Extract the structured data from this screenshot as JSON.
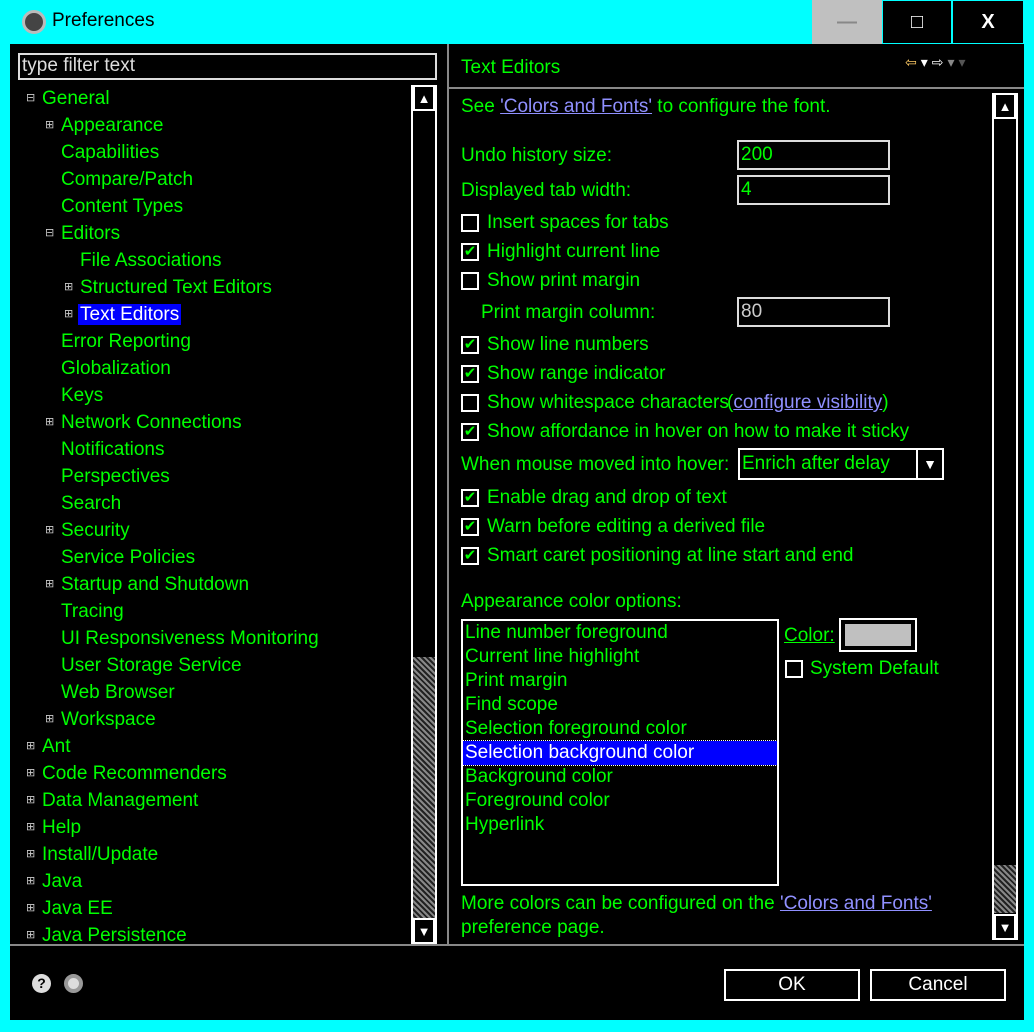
{
  "window": {
    "title": "Preferences",
    "minimize": "—",
    "maximize": "□",
    "close": "X"
  },
  "filter": {
    "placeholder": "type filter text"
  },
  "tree": [
    {
      "label": "General",
      "depth": 0,
      "exp": "-"
    },
    {
      "label": "Appearance",
      "depth": 1,
      "exp": "+"
    },
    {
      "label": "Capabilities",
      "depth": 1,
      "exp": ""
    },
    {
      "label": "Compare/Patch",
      "depth": 1,
      "exp": ""
    },
    {
      "label": "Content Types",
      "depth": 1,
      "exp": ""
    },
    {
      "label": "Editors",
      "depth": 1,
      "exp": "-"
    },
    {
      "label": "File Associations",
      "depth": 2,
      "exp": ""
    },
    {
      "label": "Structured Text Editors",
      "depth": 2,
      "exp": "+"
    },
    {
      "label": "Text Editors",
      "depth": 2,
      "exp": "+",
      "selected": true
    },
    {
      "label": "Error Reporting",
      "depth": 1,
      "exp": ""
    },
    {
      "label": "Globalization",
      "depth": 1,
      "exp": ""
    },
    {
      "label": "Keys",
      "depth": 1,
      "exp": ""
    },
    {
      "label": "Network Connections",
      "depth": 1,
      "exp": "+"
    },
    {
      "label": "Notifications",
      "depth": 1,
      "exp": ""
    },
    {
      "label": "Perspectives",
      "depth": 1,
      "exp": ""
    },
    {
      "label": "Search",
      "depth": 1,
      "exp": ""
    },
    {
      "label": "Security",
      "depth": 1,
      "exp": "+"
    },
    {
      "label": "Service Policies",
      "depth": 1,
      "exp": ""
    },
    {
      "label": "Startup and Shutdown",
      "depth": 1,
      "exp": "+"
    },
    {
      "label": "Tracing",
      "depth": 1,
      "exp": ""
    },
    {
      "label": "UI Responsiveness Monitoring",
      "depth": 1,
      "exp": ""
    },
    {
      "label": "User Storage Service",
      "depth": 1,
      "exp": ""
    },
    {
      "label": "Web Browser",
      "depth": 1,
      "exp": ""
    },
    {
      "label": "Workspace",
      "depth": 1,
      "exp": "+"
    },
    {
      "label": "Ant",
      "depth": 0,
      "exp": "+"
    },
    {
      "label": "Code Recommenders",
      "depth": 0,
      "exp": "+"
    },
    {
      "label": "Data Management",
      "depth": 0,
      "exp": "+"
    },
    {
      "label": "Help",
      "depth": 0,
      "exp": "+"
    },
    {
      "label": "Install/Update",
      "depth": 0,
      "exp": "+"
    },
    {
      "label": "Java",
      "depth": 0,
      "exp": "+"
    },
    {
      "label": "Java EE",
      "depth": 0,
      "exp": "+"
    },
    {
      "label": "Java Persistence",
      "depth": 0,
      "exp": "+"
    }
  ],
  "page": {
    "title": "Text Editors",
    "intro_pre": "See ",
    "intro_link": "'Colors and Fonts'",
    "intro_post": " to configure the font.",
    "undo_label": "Undo history size:",
    "undo_value": "200",
    "tab_label": "Displayed tab width:",
    "tab_value": "4",
    "checkboxes": [
      {
        "label": "Insert spaces for tabs",
        "checked": false
      },
      {
        "label": "Highlight current line",
        "checked": true
      },
      {
        "label": "Show print margin",
        "checked": false
      }
    ],
    "margin_label": "Print margin column:",
    "margin_value": "80",
    "checkboxes2": [
      {
        "label": "Show line numbers",
        "checked": true
      },
      {
        "label": "Show range indicator",
        "checked": true
      },
      {
        "label": "Show whitespace characters",
        "checked": false
      },
      {
        "label": "Show affordance in hover on how to make it sticky",
        "checked": true
      }
    ],
    "whitespace_link_open": "(",
    "whitespace_link": "configure visibility",
    "whitespace_link_close": ")",
    "hover_label": "When mouse moved into hover:",
    "hover_value": "Enrich after delay",
    "checkboxes3": [
      {
        "label": "Enable drag and drop of text",
        "checked": true
      },
      {
        "label": "Warn before editing a derived file",
        "checked": true
      },
      {
        "label": "Smart caret positioning at line start and end",
        "checked": true
      }
    ],
    "appearance_label": "Appearance color options:",
    "color_items": [
      "Line number foreground",
      "Current line highlight",
      "Print margin",
      "Find scope",
      "Selection foreground color",
      "Selection background color",
      "Background color",
      "Foreground color",
      "Hyperlink"
    ],
    "selected_color_item": "Selection background color",
    "color_label": "Color:",
    "color_value": "#c0c0c0",
    "system_default": "System Default",
    "system_default_checked": false,
    "more_pre": "More colors can be configured on the ",
    "more_link": "'Colors and Fonts'",
    "more_post": "preference page."
  },
  "footer": {
    "ok": "OK",
    "cancel": "Cancel",
    "help_icon": "help-icon",
    "import_icon": "import-export-icon"
  },
  "colors": {
    "frame": "#00ffff",
    "text": "#00ff00",
    "selection": "#0000ff",
    "link": "#9090ff"
  }
}
